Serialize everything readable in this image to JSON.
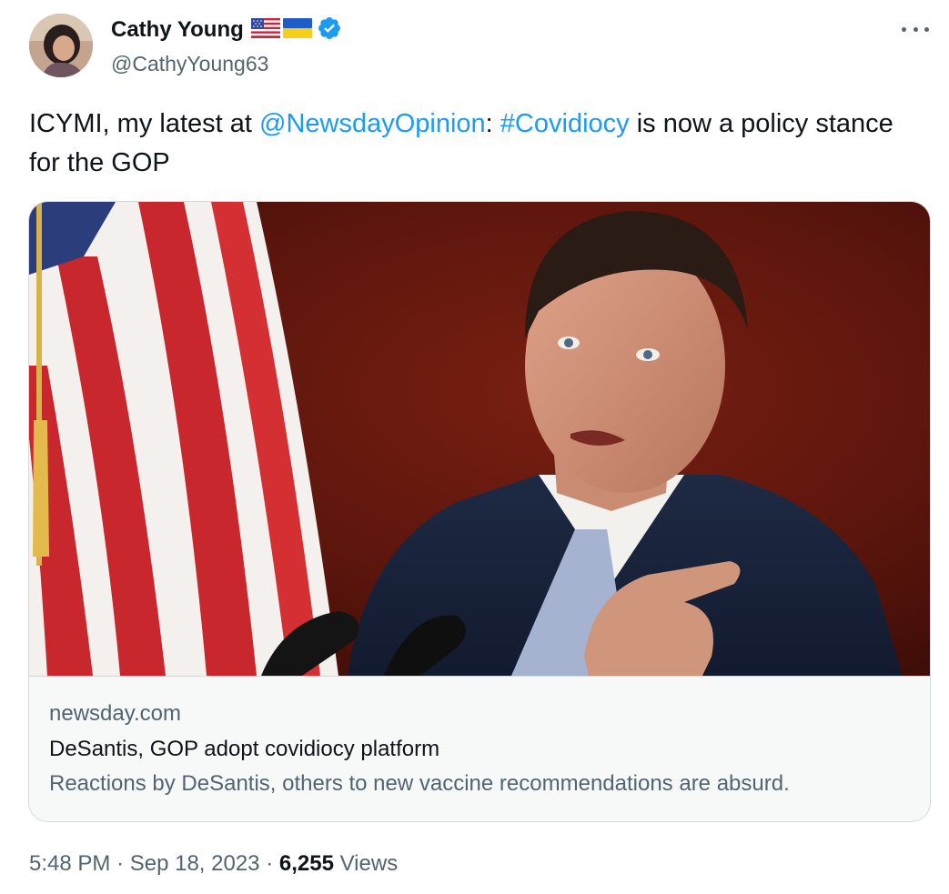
{
  "author": {
    "display_name": "Cathy Young",
    "handle": "@CathyYoung63",
    "flags": [
      "us-flag-icon",
      "ukraine-flag-icon"
    ],
    "verified": true
  },
  "tweet": {
    "text_before": "ICYMI, my latest at ",
    "mention": "@NewsdayOpinion",
    "text_middle": ": ",
    "hashtag": "#Covidiocy",
    "text_after": " is now a policy stance for the GOP"
  },
  "card": {
    "domain": "newsday.com",
    "title": "DeSantis, GOP adopt covidiocy platform",
    "description": "Reactions by DeSantis, others to new vaccine recommendations are absurd."
  },
  "meta": {
    "time": "5:48 PM",
    "separator": "·",
    "date": "Sep 18, 2023",
    "views_count": "6,255",
    "views_label": "Views"
  },
  "colors": {
    "link": "#1d9bf0",
    "text": "#0f1419",
    "secondary": "#536471",
    "border": "#cfd9de",
    "card_bg": "#f7f9f9"
  }
}
